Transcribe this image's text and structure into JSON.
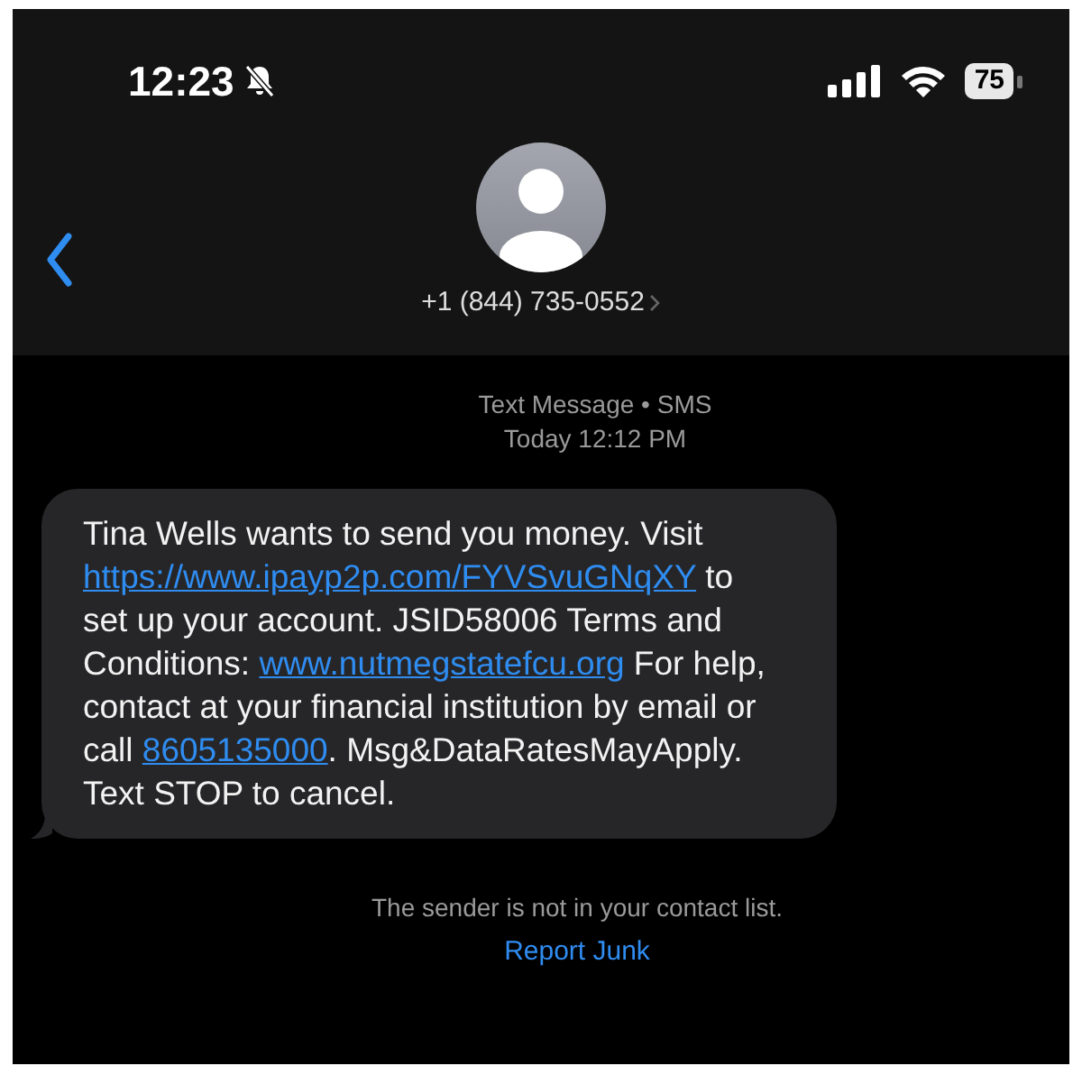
{
  "status_bar": {
    "time": "12:23",
    "battery": "75"
  },
  "header": {
    "contact": "+1 (844) 735-0552"
  },
  "thread": {
    "service": "Text Message • SMS",
    "timestamp": "Today 12:12 PM",
    "message": [
      {
        "kind": "text",
        "text": "Tina Wells wants to send you money. Visit "
      },
      {
        "kind": "link",
        "text": "https://www.ipayp2p.com/FYVSvuGNqXY"
      },
      {
        "kind": "text",
        "text": " to set up your account. JSID58006 Terms and Conditions: "
      },
      {
        "kind": "link",
        "text": "www.nutmegstatefcu.org"
      },
      {
        "kind": "text",
        "text": " For help, contact at your financial institution by email or call "
      },
      {
        "kind": "link",
        "text": "8605135000"
      },
      {
        "kind": "text",
        "text": ". Msg&DataRatesMayApply. Text STOP to cancel."
      }
    ],
    "notice": "The sender is not in your contact list.",
    "action": "Report Junk"
  }
}
